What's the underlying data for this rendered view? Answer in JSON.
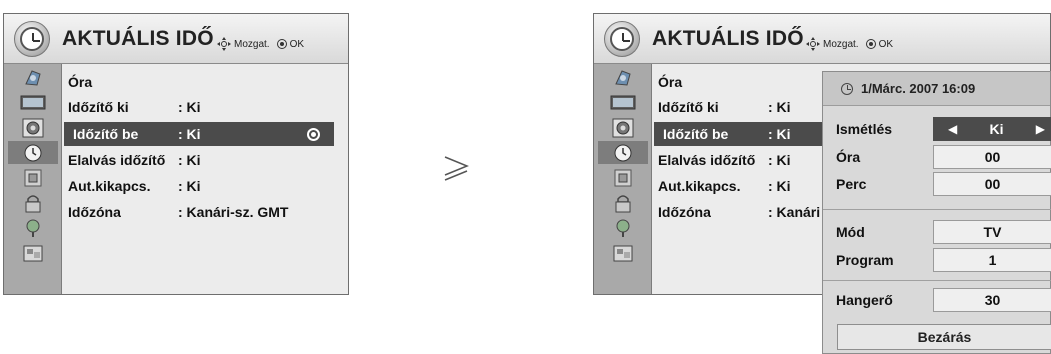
{
  "left_menu": {
    "title": "AKTUÁLIS IDŐ",
    "hint_move": "Mozgat.",
    "hint_ok": "OK",
    "rows": [
      {
        "label": "Óra",
        "value": ""
      },
      {
        "label": "Időzítő ki",
        "value": ": Ki"
      },
      {
        "label": "Időzítő be",
        "value": ": Ki"
      },
      {
        "label": "Elalvás időzítő",
        "value": ": Ki"
      },
      {
        "label": "Aut.kikapcs.",
        "value": ": Ki"
      },
      {
        "label": "Időzóna",
        "value": ": Kanári-sz. GMT"
      }
    ]
  },
  "right_menu": {
    "title": "AKTUÁLIS IDŐ",
    "hint_move": "Mozgat.",
    "hint_ok": "OK",
    "rows": [
      {
        "label": "Óra",
        "value": ""
      },
      {
        "label": "Időzítő ki",
        "value": ": Ki"
      },
      {
        "label": "Időzítő be",
        "value": ": Ki"
      },
      {
        "label": "Elalvás időzítő",
        "value": ": Ki"
      },
      {
        "label": "Aut.kikapcs.",
        "value": ": Ki"
      },
      {
        "label": "Időzóna",
        "value": ": Kanári"
      }
    ]
  },
  "category_icons": [
    "setup-icon",
    "picture-icon",
    "audio-icon",
    "time-icon",
    "lock-icon",
    "option-icon",
    "input-icon",
    "usb-icon"
  ],
  "selected_category": "time-icon",
  "arrow": "≥",
  "popup": {
    "datetime": "1/Márc. 2007 16:09",
    "repeat_label": "Ismétlés",
    "repeat_value": "Ki",
    "hour_label": "Óra",
    "hour_value": "00",
    "minute_label": "Perc",
    "minute_value": "00",
    "mode_label": "Mód",
    "mode_value": "TV",
    "program_label": "Program",
    "program_value": "1",
    "volume_label": "Hangerő",
    "volume_value": "30",
    "close_label": "Bezárás"
  }
}
